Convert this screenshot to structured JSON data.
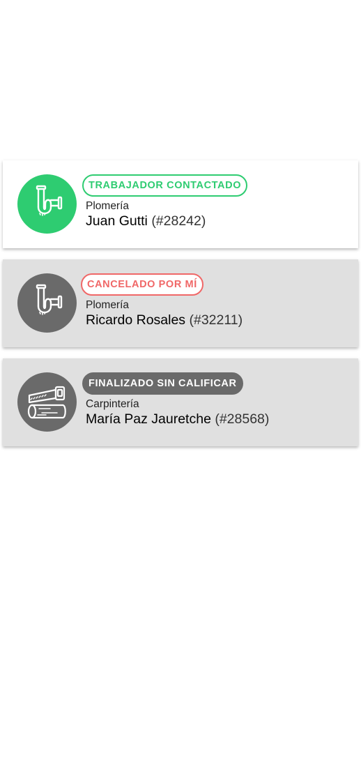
{
  "colors": {
    "active_green": "#2ecc71",
    "cancel_red": "#f06767",
    "inactive_gray": "#6a6a6a",
    "card_inactive_bg": "#e0e0e0"
  },
  "requests": [
    {
      "status": "TRABAJADOR CONTACTADO",
      "category": "Plomería",
      "worker_name": "Juan Gutti",
      "worker_id": "(#28242)",
      "icon": "pipe-icon"
    },
    {
      "status": "CANCELADO POR MÍ",
      "category": "Plomería",
      "worker_name": "Ricardo Rosales",
      "worker_id": "(#32211)",
      "icon": "pipe-icon"
    },
    {
      "status": "FINALIZADO SIN CALIFICAR",
      "category": "Carpintería",
      "worker_name": "María Paz Jauretche",
      "worker_id": "(#28568)",
      "icon": "saw-wood-icon"
    }
  ]
}
